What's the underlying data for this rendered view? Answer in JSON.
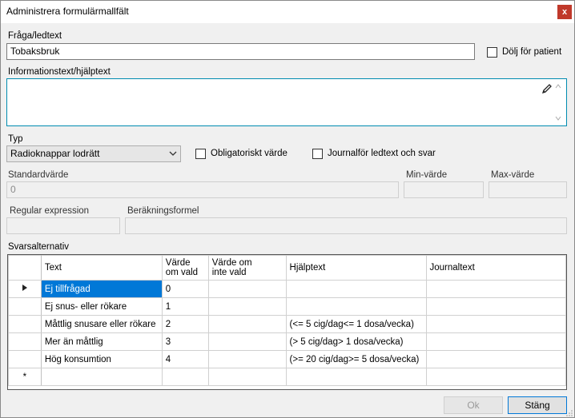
{
  "window": {
    "title": "Administrera formulärmallfält",
    "close_label": "x"
  },
  "question": {
    "label": "Fråga/ledtext",
    "value": "Tobaksbruk"
  },
  "hide_for_patient": {
    "label": "Dölj för patient",
    "checked": false
  },
  "info": {
    "label": "Informationstext/hjälptext",
    "value": ""
  },
  "type": {
    "label": "Typ",
    "selected": "Radioknappar lodrätt"
  },
  "mandatory": {
    "label": "Obligatoriskt värde",
    "checked": false
  },
  "journal_text": {
    "label": "Journalför ledtext och svar",
    "checked": false
  },
  "default_value": {
    "label": "Standardvärde",
    "value": "0"
  },
  "min_value": {
    "label": "Min-värde",
    "value": ""
  },
  "max_value": {
    "label": "Max-värde",
    "value": ""
  },
  "regex": {
    "label": "Regular expression",
    "value": ""
  },
  "formula": {
    "label": "Beräkningsformel",
    "value": ""
  },
  "answers": {
    "label": "Svarsalternativ",
    "columns": [
      "Text",
      "Värde om vald",
      "Värde om inte vald",
      "Hjälptext",
      "Journaltext"
    ],
    "col_text": "Text",
    "col_value_line1": "Värde",
    "col_value_line2": "om vald",
    "col_notvalue_line1": "Värde om",
    "col_notvalue_line2": "inte vald",
    "col_help": "Hjälptext",
    "col_journal": "Journaltext",
    "new_row_marker": "*",
    "rows": [
      {
        "text": "Ej tillfrågad",
        "value": "0",
        "not_value": "",
        "help": "",
        "journal": ""
      },
      {
        "text": "Ej snus- eller rökare",
        "value": "1",
        "not_value": "",
        "help": "",
        "journal": ""
      },
      {
        "text": "Måttlig snusare eller rökare",
        "value": "2",
        "not_value": "",
        "help": "(<= 5 cig/dag<= 1 dosa/vecka)",
        "journal": ""
      },
      {
        "text": "Mer än måttlig",
        "value": "3",
        "not_value": "",
        "help": "(> 5 cig/dag> 1 dosa/vecka)",
        "journal": ""
      },
      {
        "text": "Hög konsumtion",
        "value": "4",
        "not_value": "",
        "help": "(>= 20 cig/dag>= 5 dosa/vecka)",
        "journal": ""
      }
    ]
  },
  "buttons": {
    "ok": "Ok",
    "close": "Stäng"
  },
  "colors": {
    "selection": "#0078d7",
    "focus_border": "#008bb0",
    "close_button": "#c0392b"
  }
}
